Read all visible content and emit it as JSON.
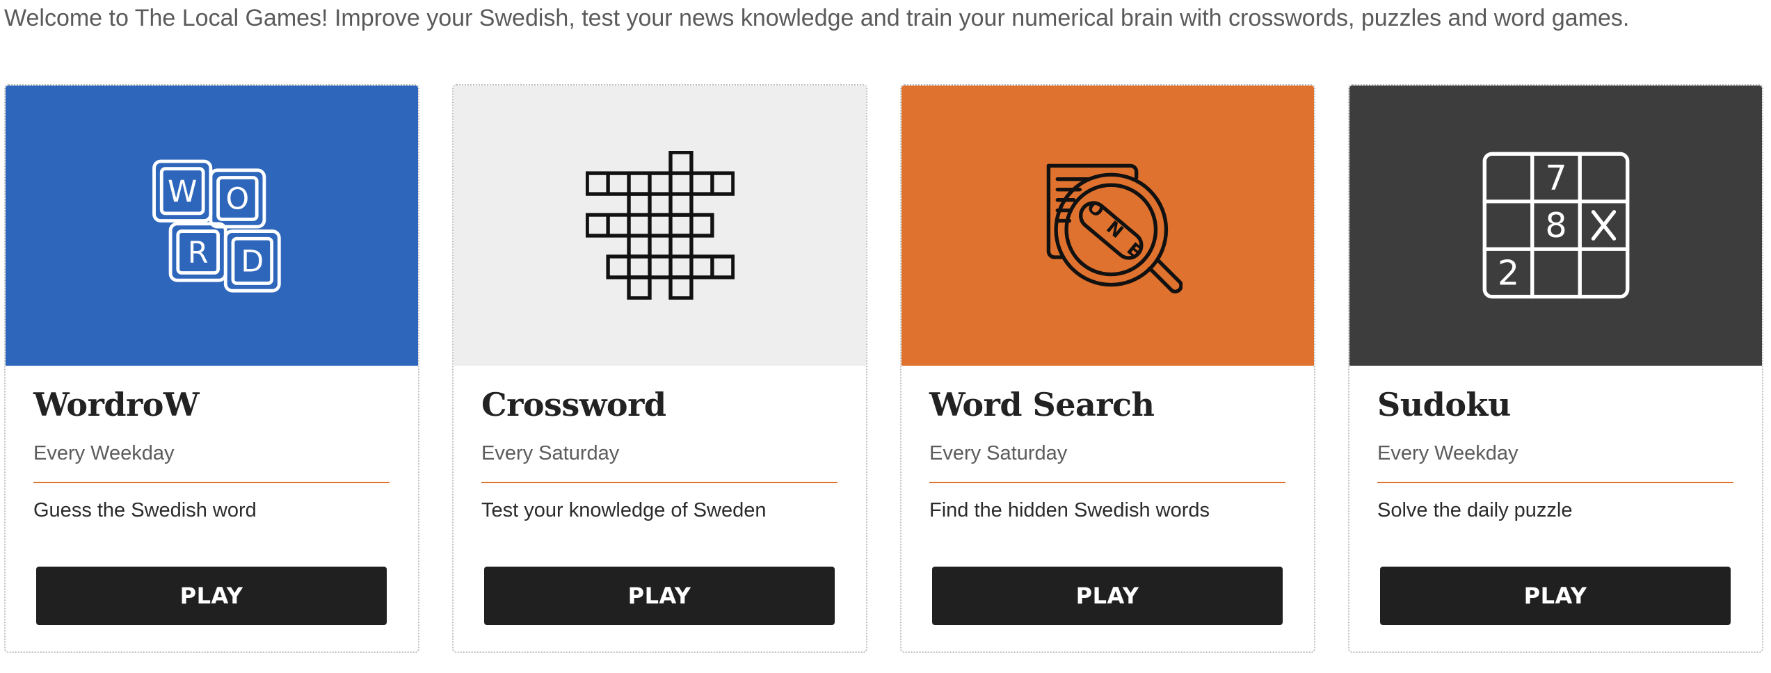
{
  "intro_text": "Welcome to The Local Games! Improve your Swedish, test your news knowledge and train your numerical brain with crosswords, puzzles and word games.",
  "accent_color": "#df7230",
  "cards": [
    {
      "title": "WordroW",
      "schedule": "Every Weekday",
      "description": "Guess the Swedish word",
      "button_label": "PLAY",
      "banner_color": "#2d66bb",
      "icon": "word-tiles-icon",
      "icon_letters": [
        "W",
        "O",
        "R",
        "D"
      ]
    },
    {
      "title": "Crossword",
      "schedule": "Every Saturday",
      "description": "Test your knowledge of Sweden",
      "button_label": "PLAY",
      "banner_color": "#eeeeee",
      "icon": "crossword-grid-icon"
    },
    {
      "title": "Word Search",
      "schedule": "Every Saturday",
      "description": "Find the hidden Swedish words",
      "button_label": "PLAY",
      "banner_color": "#df722e",
      "icon": "magnifier-word-icon",
      "icon_letters": [
        "O",
        "N",
        "E"
      ]
    },
    {
      "title": "Sudoku",
      "schedule": "Every Weekday",
      "description": "Solve the daily puzzle",
      "button_label": "PLAY",
      "banner_color": "#3d3d3d",
      "icon": "sudoku-grid-icon",
      "icon_values": [
        "7",
        "8",
        "2"
      ]
    }
  ]
}
